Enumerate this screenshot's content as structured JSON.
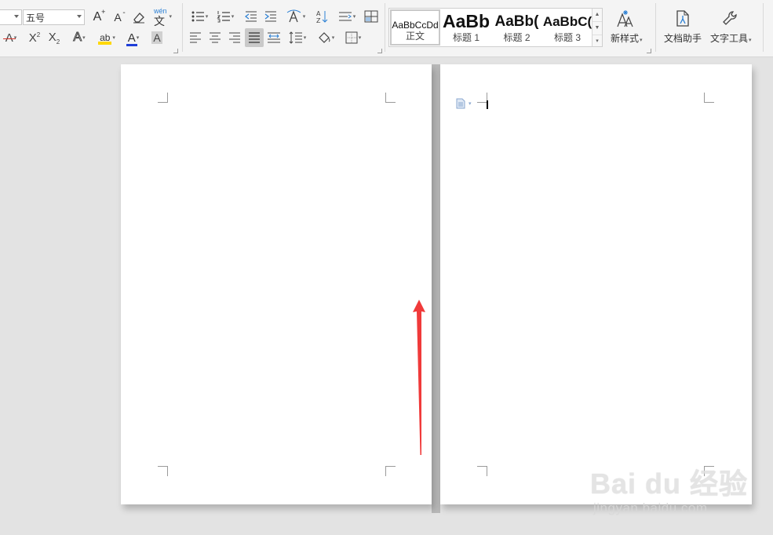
{
  "toolbar": {
    "font_size_value": "五号",
    "phonetic_label": "wén",
    "phonetic_char": "文",
    "styles": [
      {
        "sample": "AaBbCcDd",
        "name": "正文"
      },
      {
        "sample": "AaBb",
        "name": "标题 1"
      },
      {
        "sample": "AaBb(",
        "name": "标题 2"
      },
      {
        "sample": "AaBbC(",
        "name": "标题 3"
      }
    ],
    "new_style_label": "新样式",
    "doc_assistant_label": "文档助手",
    "text_tools_label": "文字工具",
    "grow_font_glyph": "A",
    "shrink_font_glyph": "A",
    "text_effect_glyph": "A",
    "font_color_glyph": "A",
    "char_shading_glyph": "A",
    "highlight_glyph": "ab",
    "strikethrough_glyph": "A"
  },
  "colors": {
    "highlight": "#ffd800",
    "font_color": "#1f3fd8",
    "strike_color": "#d9342b",
    "annotation_arrow": "#f03a3a"
  },
  "watermark": {
    "brand": "Bai du 经验",
    "url": "jingyan.baidu.com"
  }
}
